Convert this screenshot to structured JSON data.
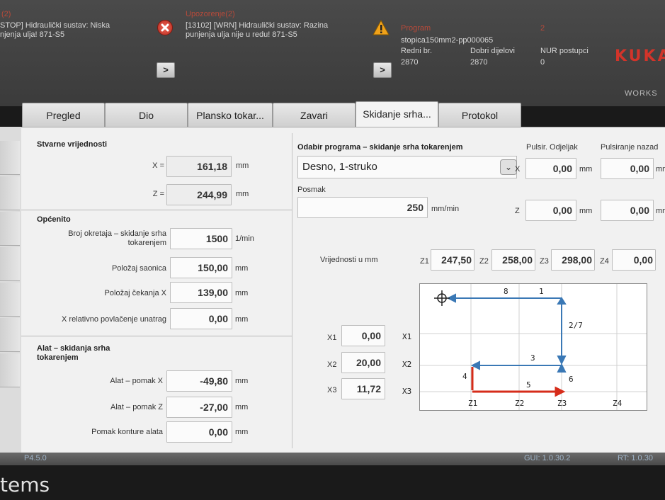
{
  "header": {
    "msg1": {
      "count": "(2)",
      "line1": "STOP] Hidraulički sustav: Niska",
      "line2": "njenja ulja! 871-S5"
    },
    "msg2": {
      "title": "Upozorenje(2)",
      "line1": "[13102] [WRN] Hidraulički sustav: Razina",
      "line2": "punjenja ulja nije u redu! 871-S5"
    },
    "program": {
      "title": "Program",
      "name": "stopica150mm2-pp000065",
      "redni_label": "Redni br.",
      "redni_value": "2870",
      "dobri_label": "Dobri dijelovi",
      "dobri_value": "2870",
      "nur_label": "NUR postupci",
      "nur_value": "0",
      "right_count": "2"
    },
    "next_button": ">",
    "logo": "KUKA",
    "work_label": "WORKS"
  },
  "tabs": [
    "Pregled",
    "Dio",
    "Plansko tokar...",
    "Zavari",
    "Skidanje srha...",
    "Protokol"
  ],
  "actual": {
    "title": "Stvarne vrijednosti",
    "x_label": "X =",
    "x_value": "161,18",
    "x_unit": "mm",
    "z_label": "Z =",
    "z_value": "244,99",
    "z_unit": "mm"
  },
  "general": {
    "title": "Općenito",
    "rows": [
      {
        "label1": "Broj okretaja – skidanje srha",
        "label2": "tokarenjem",
        "value": "1500",
        "unit": "1/min"
      },
      {
        "label1": "Položaj saonica",
        "label2": "",
        "value": "150,00",
        "unit": "mm"
      },
      {
        "label1": "Položaj čekanja X",
        "label2": "",
        "value": "139,00",
        "unit": "mm"
      },
      {
        "label1": "X relativno povlačenje unatrag",
        "label2": "",
        "value": "0,00",
        "unit": "mm"
      }
    ]
  },
  "tool": {
    "title1": "Alat – skidanja srha",
    "title2": "tokarenjem",
    "rows": [
      {
        "label": "Alat – pomak X",
        "value": "-49,80",
        "unit": "mm"
      },
      {
        "label": "Alat – pomak Z",
        "value": "-27,00",
        "unit": "mm"
      },
      {
        "label": "Pomak konture alata",
        "value": "0,00",
        "unit": "mm"
      }
    ]
  },
  "program_select": {
    "title": "Odabir programa – skidanje srha tokarenjem",
    "selected": "Desno, 1-struko",
    "feed_label": "Posmak",
    "feed_value": "250",
    "feed_unit": "mm/min"
  },
  "pulse": {
    "odjeljak_title": "Pulsir. Odjeljak",
    "nazad_title": "Pulsiranje nazad",
    "x_label": "X",
    "x_value": "0,00",
    "x_unit": "mm",
    "x_back": "0,00",
    "z_label": "Z",
    "z_value": "0,00",
    "z_unit": "mm",
    "z_back": "0,00",
    "back_unit": "mm"
  },
  "zvalues": {
    "label": "Vrijednosti u mm",
    "items": [
      {
        "name": "Z1",
        "value": "247,50"
      },
      {
        "name": "Z2",
        "value": "258,00"
      },
      {
        "name": "Z3",
        "value": "298,00"
      },
      {
        "name": "Z4",
        "value": "0,00"
      }
    ]
  },
  "xvalues": [
    {
      "name": "X1",
      "value": "0,00"
    },
    {
      "name": "X2",
      "value": "20,00"
    },
    {
      "name": "X3",
      "value": "11,72"
    }
  ],
  "diagram": {
    "row_labels": [
      "X1",
      "X2",
      "X3"
    ],
    "col_labels": [
      "Z1",
      "Z2",
      "Z3",
      "Z4"
    ],
    "step_labels": [
      "8",
      "1",
      "2/7",
      "3",
      "4",
      "5",
      "6"
    ],
    "colors": {
      "blue": "#3a78b5",
      "red": "#d62c1a"
    }
  },
  "statusbar": {
    "version": "P4.5.0",
    "gui": "GUI: 1.0.30.2",
    "rt": "RT: 1.0.30"
  },
  "bottom_text": "tems"
}
